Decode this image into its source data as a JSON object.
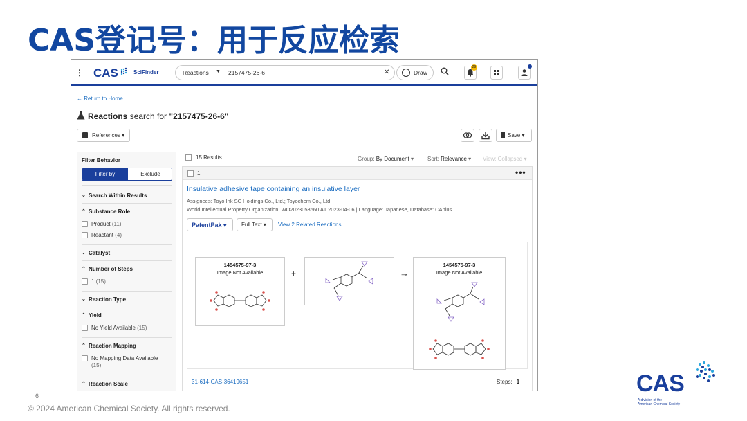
{
  "slide": {
    "title": "CAS登记号：用于反应检索",
    "page_number": "6",
    "copyright": "© 2024 American Chemical Society. All rights reserved.",
    "logo_text": "CAS",
    "logo_tagline_1": "A division of the",
    "logo_tagline_2": "American Chemical Society",
    "brand_color": "#1247a0"
  },
  "app": {
    "brand": "CAS",
    "product": "SciFinder",
    "search_type": "Reactions",
    "search_value": "2157475-26-6",
    "draw_label": "Draw",
    "notification_count": "29",
    "accent_color": "#1a3f9c"
  },
  "page": {
    "return_link": "Return to Home",
    "heading_bold": "Reactions",
    "heading_rest": " search for ",
    "heading_query": "\"2157475-26-6\"",
    "references_label": "References",
    "save_label": "Save"
  },
  "filters": {
    "title": "Filter Behavior",
    "filter_by": "Filter by",
    "exclude": "Exclude",
    "sections": {
      "search_within": "Search Within Results",
      "substance_role": "Substance Role",
      "catalyst": "Catalyst",
      "number_of_steps": "Number of Steps",
      "reaction_type": "Reaction Type",
      "yield": "Yield",
      "reaction_mapping": "Reaction Mapping",
      "reaction_scale": "Reaction Scale"
    },
    "options": {
      "product": "Product",
      "product_count": "(11)",
      "reactant": "Reactant",
      "reactant_count": "(4)",
      "steps_1": "1",
      "steps_1_count": "(15)",
      "no_yield": "No Yield Available",
      "no_yield_count": "(15)",
      "no_mapping": "No Mapping Data Available",
      "no_mapping_count": "(15)"
    }
  },
  "results": {
    "count": "15 Results",
    "group_label": "Group:",
    "group_value": "By Document",
    "sort_label": "Sort:",
    "sort_value": "Relevance",
    "view_label": "View:",
    "view_value": "Collapsed"
  },
  "card": {
    "number": "1",
    "title": "Insulative adhesive tape containing an insulative layer",
    "assignees": "Assignees: Toyo Ink SC Holdings Co., Ltd.; Toyochem Co., Ltd.",
    "source": "World Intellectual Property Organization, WO2023053560 A1 2023-04-06 | Language: Japanese, Database: CAplus",
    "patentpak": "PatentPak",
    "full_text": "Full Text",
    "related": "View 2 Related Reactions",
    "reactant_cas": "1454575-97-3",
    "reactant_note": "Image Not Available",
    "product_cas": "1454575-97-3",
    "product_note": "Image Not Available",
    "reaction_id": "31-614-CAS-36419651",
    "steps_label": "Steps:",
    "steps_value": "1"
  }
}
